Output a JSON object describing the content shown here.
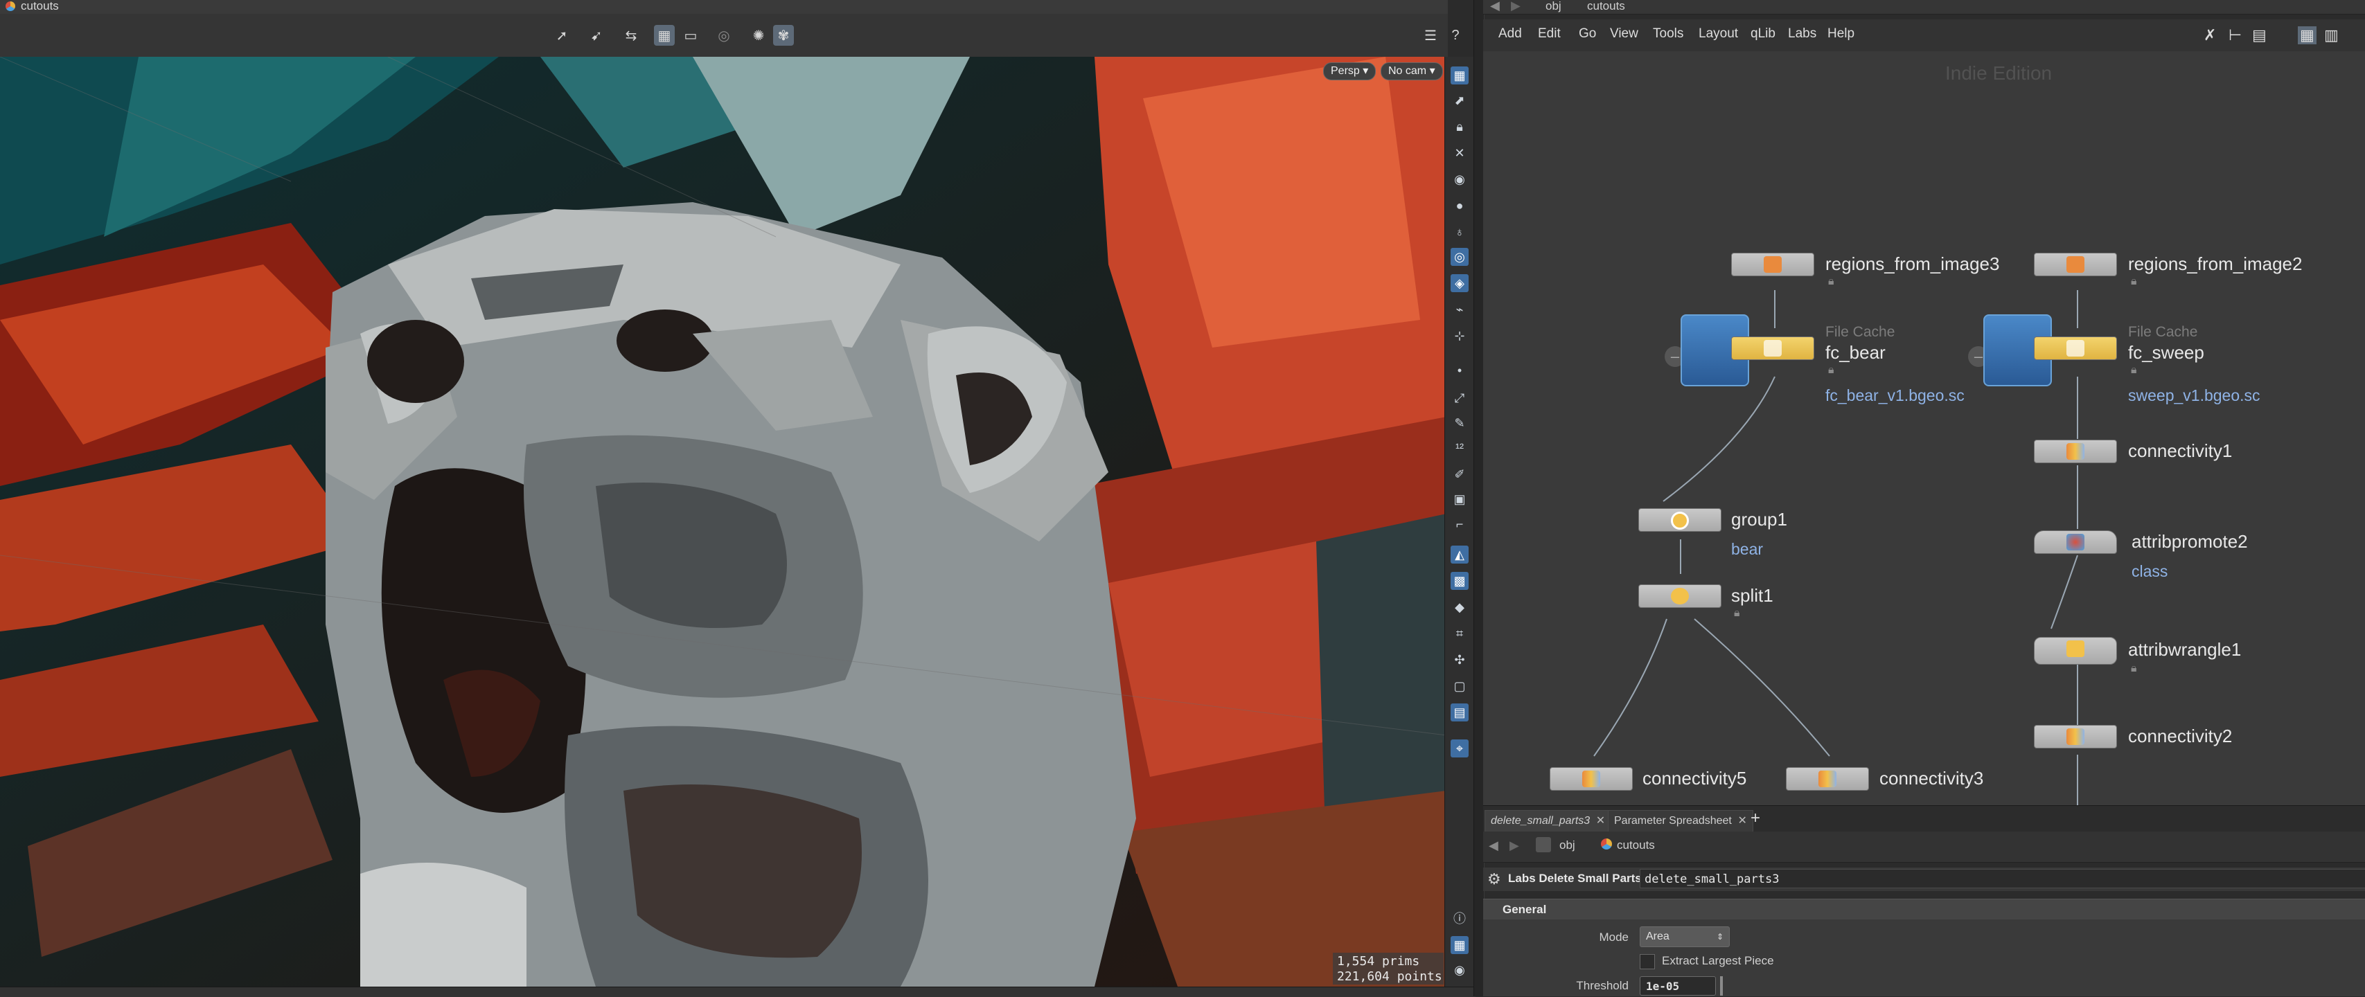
{
  "viewport": {
    "path_label": "cutouts",
    "camera_persp": "Persp",
    "camera_nocam": "No cam",
    "stats": {
      "prims": "1,554  prims",
      "points": "221,604 points"
    }
  },
  "network": {
    "path_obj": "obj",
    "path_geo": "cutouts",
    "menu": [
      "Add",
      "Edit",
      "Go",
      "View",
      "Tools",
      "Layout",
      "qLib",
      "Labs",
      "Help"
    ],
    "watermark": "Indie Edition",
    "nodes": {
      "regions3": "regions_from_image3",
      "regions2": "regions_from_image2",
      "filecache_type": "File Cache",
      "fc_bear": "fc_bear",
      "fc_bear_file": "fc_bear_v1.bgeo.sc",
      "fc_sweep": "fc_sweep",
      "fc_sweep_file": "sweep_v1.bgeo.sc",
      "group1": "group1",
      "group1_sub": "bear",
      "split1": "split1",
      "connectivity5": "connectivity5",
      "connectivity3": "connectivity3",
      "connectivity1": "connectivity1",
      "attribpromote2": "attribpromote2",
      "attribpromote2_sub": "class",
      "attribwrangle1": "attribwrangle1",
      "connectivity2": "connectivity2"
    }
  },
  "params": {
    "tabs": [
      "delete_small_parts3",
      "Parameter Spreadsheet"
    ],
    "path_obj": "obj",
    "path_geo": "cutouts",
    "node_type": "Labs Delete Small Parts",
    "node_name": "delete_small_parts3",
    "section": "General",
    "mode_label": "Mode",
    "mode_value": "Area",
    "extract_label": "Extract Largest Piece",
    "threshold_label": "Threshold",
    "threshold_value": "1e-05"
  },
  "colors": {
    "accent_blue": "#3f6ea2",
    "link_blue": "#8fb3e6",
    "node_yellow": "#f2c14a",
    "node_orange": "#e98a3d"
  }
}
